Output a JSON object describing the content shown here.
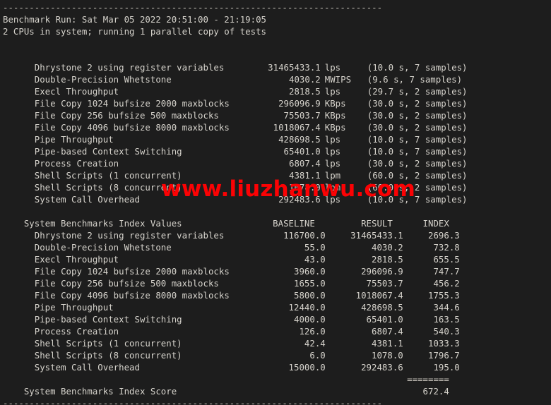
{
  "terminal": {
    "background_color": "#1d1d1d",
    "text_color": "#d6d3cc",
    "top_rule": "------------------------------------------------------------------------",
    "bottom_rule": "------------------------------------------------------------------------",
    "header": {
      "run_line": "Benchmark Run: Sat Mar 05 2022 20:51:00 - 21:19:05",
      "cpu_line": "2 CPUs in system; running 1 parallel copy of tests"
    },
    "results": [
      {
        "name": "Dhrystone 2 using register variables",
        "value": "31465433.1",
        "unit": "lps",
        "detail": "(10.0 s, 7 samples)"
      },
      {
        "name": "Double-Precision Whetstone",
        "value": "4030.2",
        "unit": "MWIPS",
        "detail": "(9.6 s, 7 samples)"
      },
      {
        "name": "Execl Throughput",
        "value": "2818.5",
        "unit": "lps",
        "detail": "(29.7 s, 2 samples)"
      },
      {
        "name": "File Copy 1024 bufsize 2000 maxblocks",
        "value": "296096.9",
        "unit": "KBps",
        "detail": "(30.0 s, 2 samples)"
      },
      {
        "name": "File Copy 256 bufsize 500 maxblocks",
        "value": "75503.7",
        "unit": "KBps",
        "detail": "(30.0 s, 2 samples)"
      },
      {
        "name": "File Copy 4096 bufsize 8000 maxblocks",
        "value": "1018067.4",
        "unit": "KBps",
        "detail": "(30.0 s, 2 samples)"
      },
      {
        "name": "Pipe Throughput",
        "value": "428698.5",
        "unit": "lps",
        "detail": "(10.0 s, 7 samples)"
      },
      {
        "name": "Pipe-based Context Switching",
        "value": "65401.0",
        "unit": "lps",
        "detail": "(10.0 s, 7 samples)"
      },
      {
        "name": "Process Creation",
        "value": "6807.4",
        "unit": "lps",
        "detail": "(30.0 s, 2 samples)"
      },
      {
        "name": "Shell Scripts (1 concurrent)",
        "value": "4381.1",
        "unit": "lpm",
        "detail": "(60.0 s, 2 samples)"
      },
      {
        "name": "Shell Scripts (8 concurrent)",
        "value": "1078.0",
        "unit": "lpm",
        "detail": "(60.0 s, 2 samples)"
      },
      {
        "name": "System Call Overhead",
        "value": "292483.6",
        "unit": "lps",
        "detail": "(10.0 s, 7 samples)"
      }
    ],
    "index_table": {
      "title": "System Benchmarks Index Values",
      "columns": {
        "baseline": "BASELINE",
        "result": "RESULT",
        "index": "INDEX"
      },
      "rows": [
        {
          "name": "Dhrystone 2 using register variables",
          "baseline": "116700.0",
          "result": "31465433.1",
          "index": "2696.3"
        },
        {
          "name": "Double-Precision Whetstone",
          "baseline": "55.0",
          "result": "4030.2",
          "index": "732.8"
        },
        {
          "name": "Execl Throughput",
          "baseline": "43.0",
          "result": "2818.5",
          "index": "655.5"
        },
        {
          "name": "File Copy 1024 bufsize 2000 maxblocks",
          "baseline": "3960.0",
          "result": "296096.9",
          "index": "747.7"
        },
        {
          "name": "File Copy 256 bufsize 500 maxblocks",
          "baseline": "1655.0",
          "result": "75503.7",
          "index": "456.2"
        },
        {
          "name": "File Copy 4096 bufsize 8000 maxblocks",
          "baseline": "5800.0",
          "result": "1018067.4",
          "index": "1755.3"
        },
        {
          "name": "Pipe Throughput",
          "baseline": "12440.0",
          "result": "428698.5",
          "index": "344.6"
        },
        {
          "name": "Pipe-based Context Switching",
          "baseline": "4000.0",
          "result": "65401.0",
          "index": "163.5"
        },
        {
          "name": "Process Creation",
          "baseline": "126.0",
          "result": "6807.4",
          "index": "540.3"
        },
        {
          "name": "Shell Scripts (1 concurrent)",
          "baseline": "42.4",
          "result": "4381.1",
          "index": "1033.3"
        },
        {
          "name": "Shell Scripts (8 concurrent)",
          "baseline": "6.0",
          "result": "1078.0",
          "index": "1796.7"
        },
        {
          "name": "System Call Overhead",
          "baseline": "15000.0",
          "result": "292483.6",
          "index": "195.0"
        }
      ],
      "separator": "========",
      "score_label": "System Benchmarks Index Score",
      "score_value": "672.4"
    }
  },
  "watermark": {
    "text": "www.liuzhanwu.com",
    "color": "#fb0204"
  }
}
